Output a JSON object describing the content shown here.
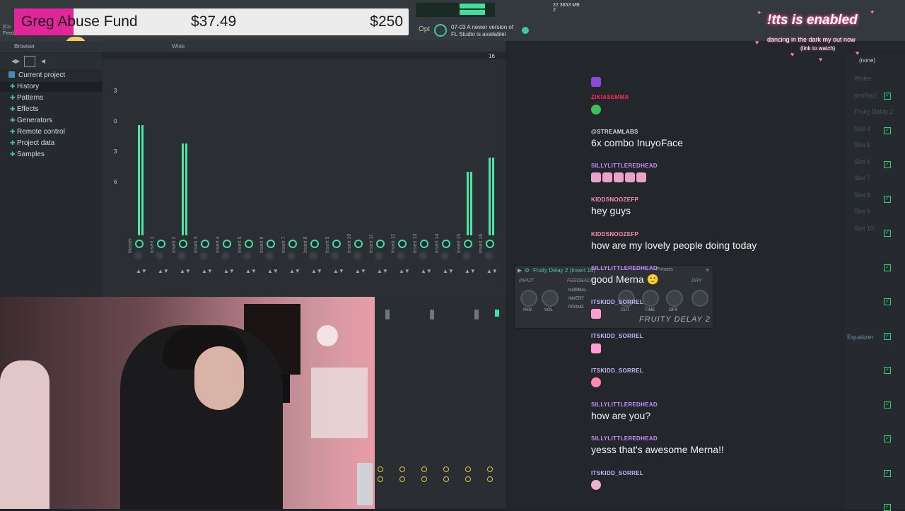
{
  "donation": {
    "title": "Greg Abuse Fund",
    "raised": "$37.49",
    "goal": "$250",
    "progress_fraction": 0.15,
    "bar_color": "#e0269a"
  },
  "toolbar": {
    "update_hint_line1": "07-03  A newer version of",
    "update_hint_line2": "FL Studio is available!",
    "opt_label": "Opt",
    "mem_line1": "22",
    "mem_line2": "3653 MB",
    "mem_line3": "2"
  },
  "browser": {
    "title": "Browser",
    "root": "Current project",
    "items": [
      "History",
      "Patterns",
      "Effects",
      "Generators",
      "Remote control",
      "Project data",
      "Samples"
    ]
  },
  "mixer": {
    "view_mode": "Wide",
    "ruler_last": "16",
    "db_marks": [
      "3",
      "0",
      "3",
      "6"
    ],
    "tracks": [
      "Master",
      "Insert 1",
      "Insert 2",
      "Insert 3",
      "Insert 4",
      "Insert 5",
      "Insert 6",
      "Insert 7",
      "Insert 8",
      "Insert 9",
      "Insert 10",
      "Insert 11",
      "Insert 12",
      "Insert 13",
      "Insert 14",
      "Insert 15",
      "Insert 16"
    ],
    "meter_levels": [
      0.78,
      0.0,
      0.65,
      0.0,
      0.0,
      0.0,
      0.0,
      0.0,
      0.0,
      0.0,
      0.0,
      0.0,
      0.0,
      0.0,
      0.0,
      0.45,
      0.55
    ]
  },
  "plugin": {
    "title": "Fruity Delay 2 (Insert 16)",
    "presets": "Presets",
    "section_input": "INPUT",
    "section_feedback": "FEEDBACK",
    "section_dry": "DRY",
    "knob_pan": "PAN",
    "knob_vol": "VOL",
    "knob_cut": "CUT",
    "knob_time": "TIME",
    "knob_ofs": "OFS",
    "mode_normal": "NORMAL",
    "mode_invert": "INVERT",
    "mode_pingpong": "PPONG",
    "logo": "FRUITY DELAY 2"
  },
  "channel_rack": {
    "selected": "(none)",
    "slots": [
      "Wider",
      "soothe2",
      "Fruity Delay 2",
      "Slot 4",
      "Slot 5",
      "Slot 6",
      "Slot 7",
      "Slot 8",
      "Slot 9",
      "Slot 10"
    ],
    "equalizer": "Equalizer"
  },
  "chat": {
    "messages": [
      {
        "user": "",
        "text": "",
        "emote": "purple-block",
        "user_color": "#b37bff"
      },
      {
        "user": "ZIKIASEMMA",
        "text": "",
        "emote": "green-face",
        "user_color": "#ff2d55"
      },
      {
        "user": "@STREAMLABS",
        "text": "6x  combo InuyoFace",
        "emote": "",
        "user_color": "#d8d8d8"
      },
      {
        "user": "SILLYLITTLEREDHEAD",
        "text": "",
        "emote": "pink-row",
        "user_color": "#c78bff"
      },
      {
        "user": "KIDDSNOOZEFP",
        "text": "hey guys",
        "emote": "",
        "user_color": "#ff8fb1"
      },
      {
        "user": "KIDDSNOOZEFP",
        "text": "how are my lovely people doing today",
        "emote": "",
        "user_color": "#ff8fb1"
      },
      {
        "user": "SILLYLITTLEREDHEAD",
        "text": "good Merna 🙂",
        "emote": "",
        "user_color": "#c78bff"
      },
      {
        "user": "ITSKIDD_SORREL",
        "text": "",
        "emote": "pink-cat",
        "user_color": "#c7b3ff"
      },
      {
        "user": "ITSKIDD_SORREL",
        "text": "",
        "emote": "pink-cat",
        "user_color": "#c7b3ff"
      },
      {
        "user": "ITSKIDD_SORREL",
        "text": "",
        "emote": "pink-blob",
        "user_color": "#c7b3ff"
      },
      {
        "user": "SILLYLITTLEREDHEAD",
        "text": "how are you?",
        "emote": "",
        "user_color": "#c78bff"
      },
      {
        "user": "SILLYLITTLEREDHEAD",
        "text": "yesss that's awesome Merna!!",
        "emote": "",
        "user_color": "#c78bff"
      },
      {
        "user": "ITSKIDD_SORREL",
        "text": "",
        "emote": "pink-drop",
        "user_color": "#c7b3ff"
      }
    ]
  },
  "tts": {
    "title": "!tts is enabled",
    "song": "dancing in the dark my out now",
    "song_sub": "(link to watch)"
  },
  "colors": {
    "accent": "#3fe0a0",
    "tts_glow": "#ff4fa1"
  }
}
